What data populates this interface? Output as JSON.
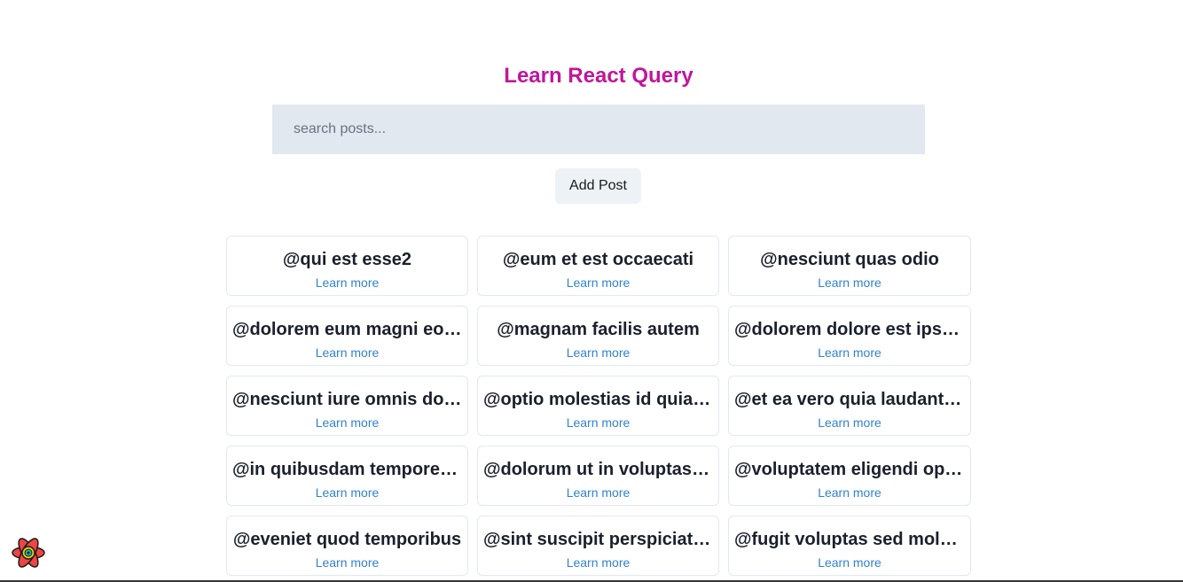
{
  "page": {
    "title": "Learn React Query"
  },
  "search": {
    "placeholder": "search posts..."
  },
  "actions": {
    "add_post_label": "Add Post"
  },
  "posts": [
    {
      "title": "@qui est esse2",
      "link": "Learn more"
    },
    {
      "title": "@eum et est occaecati",
      "link": "Learn more"
    },
    {
      "title": "@nesciunt quas odio",
      "link": "Learn more"
    },
    {
      "title": "@dolorem eum magni eos aperiam quia",
      "link": "Learn more"
    },
    {
      "title": "@magnam facilis autem",
      "link": "Learn more"
    },
    {
      "title": "@dolorem dolore est ipsam",
      "link": "Learn more"
    },
    {
      "title": "@nesciunt iure omnis dolorem tempora et accusantium",
      "link": "Learn more"
    },
    {
      "title": "@optio molestias id quia eum",
      "link": "Learn more"
    },
    {
      "title": "@et ea vero quia laudantium autem",
      "link": "Learn more"
    },
    {
      "title": "@in quibusdam tempore odit est dolorem",
      "link": "Learn more"
    },
    {
      "title": "@dolorum ut in voluptas mollitia et saepe quo animi",
      "link": "Learn more"
    },
    {
      "title": "@voluptatem eligendi optio",
      "link": "Learn more"
    },
    {
      "title": "@eveniet quod temporibus",
      "link": "Learn more"
    },
    {
      "title": "@sint suscipit perspiciatis velit dolorum rerum ipsa laboriosam odio",
      "link": "Learn more"
    },
    {
      "title": "@fugit voluptas sed molestias voluptatem provident",
      "link": "Learn more"
    }
  ],
  "devtools": {
    "icon": "react-query-devtools-icon"
  },
  "colors": {
    "title": "#c0179b",
    "link": "#3182ce",
    "input_bg": "#e2e8f0",
    "button_bg": "#edf2f7"
  }
}
